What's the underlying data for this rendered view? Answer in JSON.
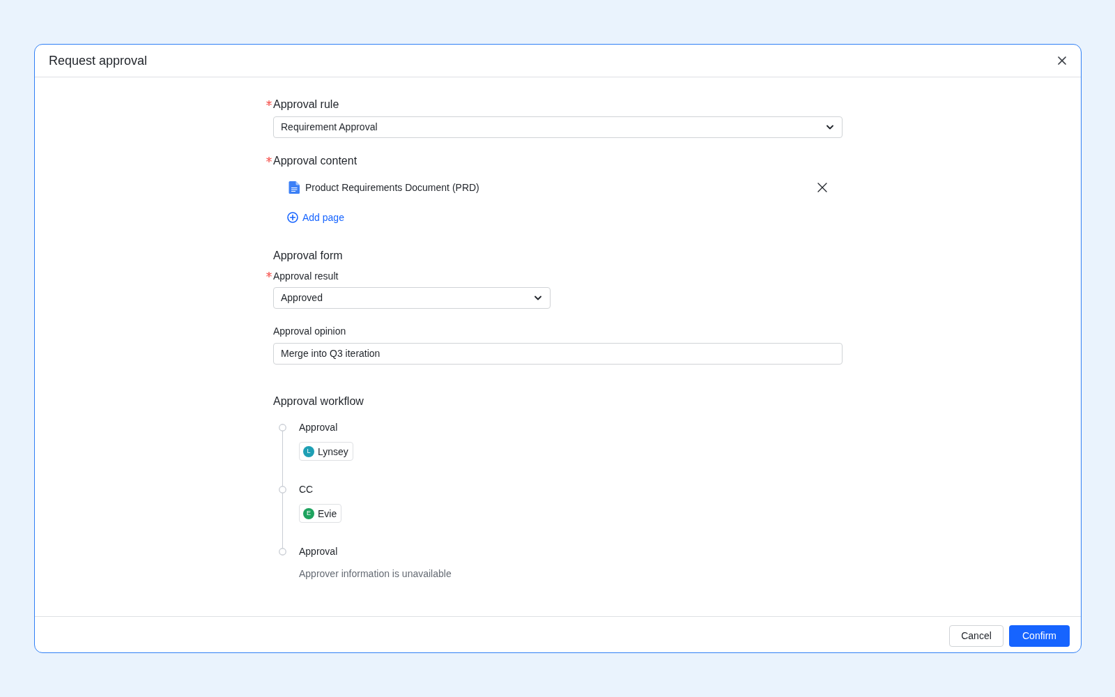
{
  "dialog": {
    "title": "Request approval"
  },
  "form": {
    "approval_rule": {
      "label": "Approval rule",
      "required": true,
      "value": "Requirement Approval"
    },
    "approval_content": {
      "label": "Approval content",
      "required": true,
      "pages": [
        {
          "title": "Product Requirements Document (PRD)"
        }
      ],
      "add_page": "Add page"
    },
    "approval_form": {
      "heading": "Approval form",
      "fields": [
        {
          "kind": "select",
          "label": "Approval result",
          "required": true,
          "value": "Approved"
        },
        {
          "kind": "input",
          "label": "Approval opinion",
          "required": false,
          "value": "Merge into Q3 iteration"
        }
      ]
    }
  },
  "workflow": {
    "heading": "Approval workflow",
    "steps": [
      {
        "kind": "assignees",
        "title": "Approval",
        "people": [
          {
            "initial": "L",
            "name": "Lynsey",
            "color": "#1e9fb4"
          }
        ]
      },
      {
        "kind": "assignees",
        "title": "CC",
        "people": [
          {
            "initial": "E",
            "name": "Evie",
            "color": "#1ea35f"
          }
        ]
      },
      {
        "kind": "note",
        "title": "Approval",
        "note": "Approver information is unavailable"
      }
    ]
  },
  "buttons": [
    {
      "kind": "secondary",
      "label": "Cancel"
    },
    {
      "kind": "primary",
      "label": "Confirm"
    }
  ]
}
